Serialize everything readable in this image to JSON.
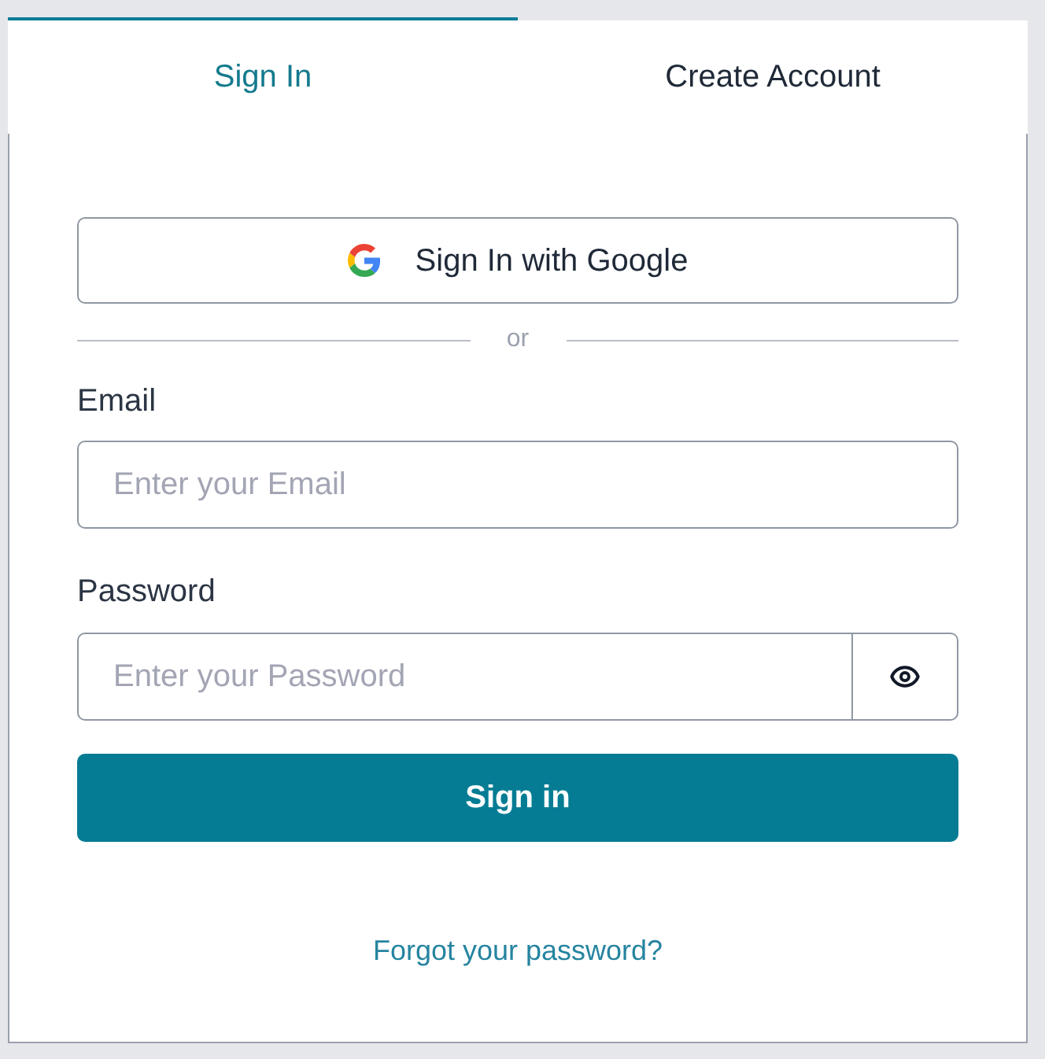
{
  "tabs": [
    {
      "label": "Sign In",
      "selected": true
    },
    {
      "label": "Create Account",
      "selected": false
    }
  ],
  "google_button": {
    "label": "Sign In with Google"
  },
  "divider": {
    "label": "or"
  },
  "email": {
    "label": "Email",
    "placeholder": "Enter your Email"
  },
  "password": {
    "label": "Password",
    "placeholder": "Enter your Password"
  },
  "submit_button": {
    "label": "Sign in"
  },
  "forgot_link": {
    "label": "Forgot your password?"
  }
}
